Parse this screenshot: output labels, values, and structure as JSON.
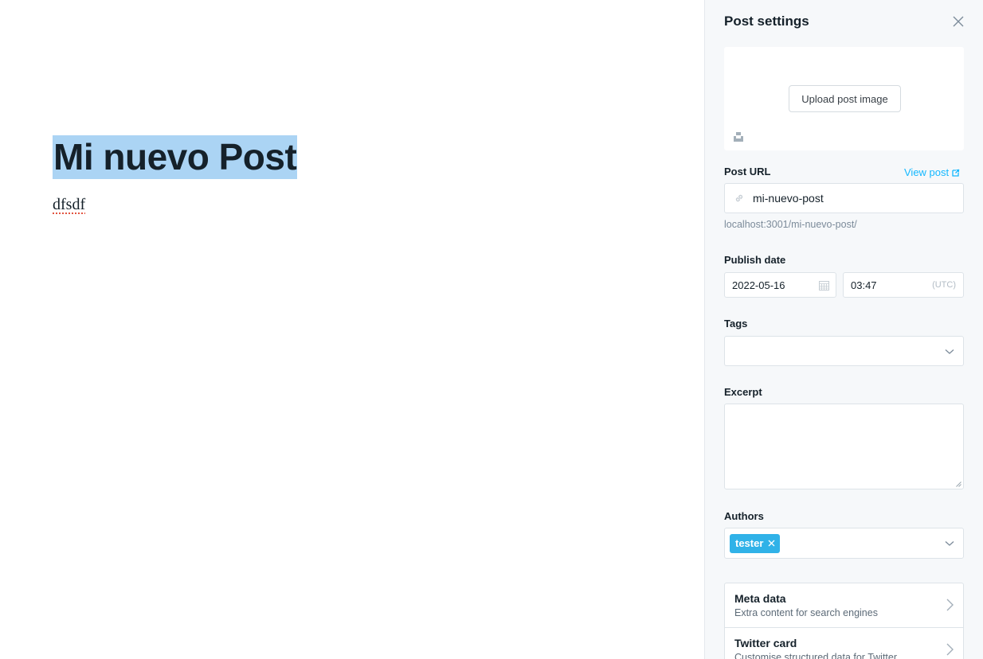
{
  "editor": {
    "title": "Mi nuevo Post",
    "body": "dfsdf"
  },
  "panel": {
    "title": "Post settings",
    "upload_label": "Upload post image",
    "post_url": {
      "label": "Post URL",
      "view_link": "View post",
      "value": "mi-nuevo-post",
      "full_url": "localhost:3001/mi-nuevo-post/"
    },
    "publish_date": {
      "label": "Publish date",
      "date": "2022-05-16",
      "time": "03:47",
      "tz": "(UTC)"
    },
    "tags": {
      "label": "Tags",
      "value": ""
    },
    "excerpt": {
      "label": "Excerpt",
      "value": ""
    },
    "authors": {
      "label": "Authors",
      "items": [
        "tester"
      ]
    },
    "sections": [
      {
        "title": "Meta data",
        "subtitle": "Extra content for search engines"
      },
      {
        "title": "Twitter card",
        "subtitle": "Customise structured data for Twitter"
      }
    ]
  },
  "colors": {
    "accent": "#14b8ff",
    "chip": "#30b2e8",
    "selection": "#abd4f4",
    "panel_bg": "#f6f8fa"
  },
  "icons": [
    "close-icon",
    "unsplash-icon",
    "external-link-icon",
    "link-icon",
    "calendar-icon",
    "chevron-down-icon",
    "chevron-right-icon"
  ]
}
